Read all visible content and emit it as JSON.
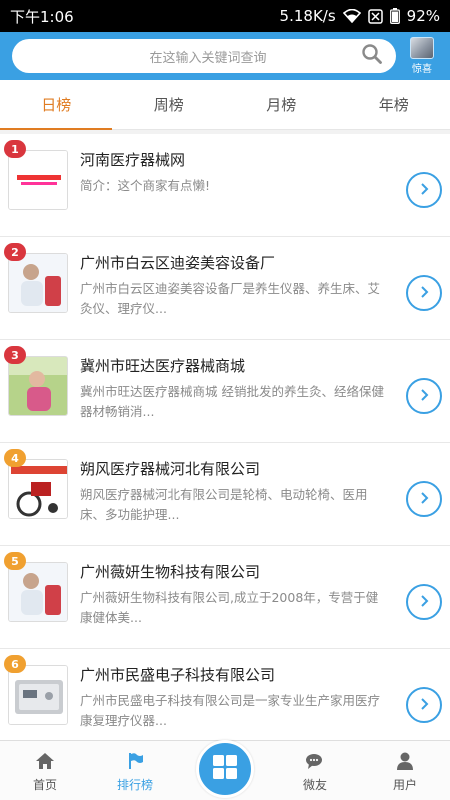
{
  "status_bar": {
    "time": "下午1:06",
    "network_speed": "5.18K/s",
    "battery": "92%",
    "icons": [
      "wifi-icon",
      "no-sim-icon",
      "battery-icon"
    ]
  },
  "header": {
    "search_placeholder": "在这输入关键词查询",
    "avatar_label": "惊喜"
  },
  "tabs": [
    {
      "label": "日榜",
      "active": true
    },
    {
      "label": "周榜",
      "active": false
    },
    {
      "label": "月榜",
      "active": false
    },
    {
      "label": "年榜",
      "active": false
    }
  ],
  "items": [
    {
      "rank": "1",
      "title": "河南医疗器械网",
      "desc": "简介：这个商家有点懒!",
      "badge_color": "#d9363e"
    },
    {
      "rank": "2",
      "title": "广州市白云区迪姿美容设备厂",
      "desc": "广州市白云区迪姿美容设备厂是养生仪器、养生床、艾灸仪、理疗仪...",
      "badge_color": "#d9363e"
    },
    {
      "rank": "3",
      "title": "冀州市旺达医疗器械商城",
      "desc": "冀州市旺达医疗器械商城 经销批发的养生灸、经络保健器材畅销消...",
      "badge_color": "#d9363e"
    },
    {
      "rank": "4",
      "title": "朔风医疗器械河北有限公司",
      "desc": "朔风医疗器械河北有限公司是轮椅、电动轮椅、医用床、多功能护理...",
      "badge_color": "#f0a030"
    },
    {
      "rank": "5",
      "title": "广州薇妍生物科技有限公司",
      "desc": "广州薇妍生物科技有限公司,成立于2008年，专营于健康健体美...",
      "badge_color": "#f0a030"
    },
    {
      "rank": "6",
      "title": "广州市民盛电子科技有限公司",
      "desc": "广州市民盛电子科技有限公司是一家专业生产家用医疗康复理疗仪器...",
      "badge_color": "#f0a030"
    }
  ],
  "bottom_nav": [
    {
      "label": "首页",
      "icon": "home-icon",
      "active": false
    },
    {
      "label": "排行榜",
      "icon": "flag-icon",
      "active": true
    },
    {
      "label": "",
      "icon": "grid-icon",
      "active": false
    },
    {
      "label": "微友",
      "icon": "chat-icon",
      "active": false
    },
    {
      "label": "用户",
      "icon": "user-icon",
      "active": false
    }
  ],
  "colors": {
    "accent": "#3aa0e3",
    "active_tab": "#e07c22"
  }
}
